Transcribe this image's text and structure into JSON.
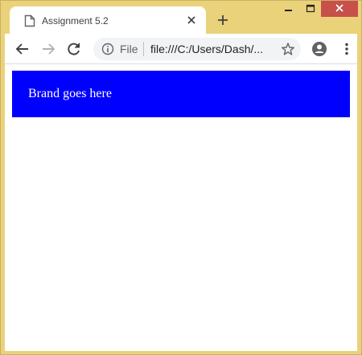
{
  "browser": {
    "tab": {
      "title": "Assignment 5.2"
    },
    "omnibox": {
      "scheme_label": "File",
      "url": "file:///C:/Users/Dash/..."
    },
    "icons": {
      "favicon": "page-icon",
      "tab_close": "close-icon",
      "new_tab": "plus-icon",
      "back": "back-arrow-icon",
      "forward": "forward-arrow-icon",
      "reload": "reload-icon",
      "info": "info-icon",
      "bookmark": "star-icon",
      "profile": "account-circle-icon",
      "menu": "kebab-menu-icon",
      "minimize": "minimize-icon",
      "maximize": "maximize-icon",
      "close_window": "close-icon"
    }
  },
  "page": {
    "brand_text": "Brand goes here"
  },
  "colors": {
    "frame": "#ead27a",
    "brand_bar": "#0000ff",
    "brand_text": "#ffffff",
    "close_button": "#c7504b"
  }
}
